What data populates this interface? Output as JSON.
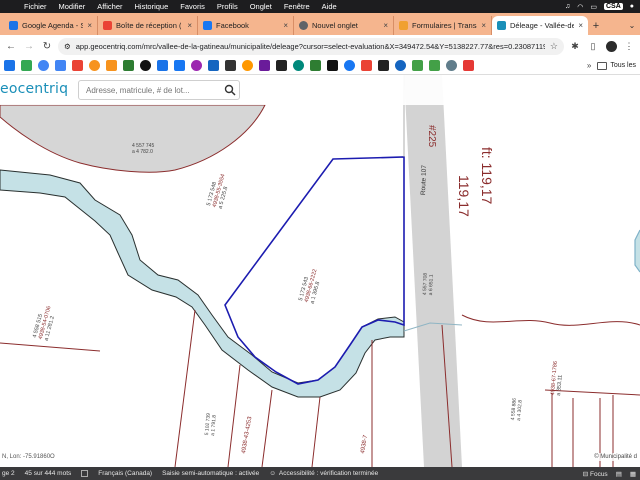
{
  "menubar": {
    "items": [
      "Fichier",
      "Modifier",
      "Afficher",
      "Historique",
      "Favoris",
      "Profils",
      "Onglet",
      "Fenêtre",
      "Aide"
    ],
    "input_lang": "CSA"
  },
  "tabs": [
    {
      "title": "Google Agenda - Se",
      "color": "#1a73e8"
    },
    {
      "title": "Boîte de réception (",
      "color": "#ea4335"
    },
    {
      "title": "Facebook",
      "color": "#1877f2"
    },
    {
      "title": "Nouvel onglet",
      "color": "#5f6368"
    },
    {
      "title": "Formulaires | Transa",
      "color": "#f0a030"
    },
    {
      "title": "Déleage - Vallée-de",
      "color": "#1a8fb8",
      "active": true
    }
  ],
  "omnibox": {
    "url": "app.geocentriq.com/mrc/vallee-de-la-gatineau/municipalite/deleage?cursor=select-evaluation&X=349472.54&Y=5138227.77&res=0.23087119..."
  },
  "bookmarks": {
    "colors": [
      "#1a73e8",
      "#34a853",
      "#4285f4",
      "#4285f4",
      "#ea4335",
      "#f7931e",
      "#f7931e",
      "#2e7d32",
      "#111111",
      "#1a73e8",
      "#1877f2",
      "#9c27b0",
      "#1565c0",
      "#333333",
      "#ff9800",
      "#6a1b9a",
      "#222222",
      "#00897b",
      "#2e7d32",
      "#111111",
      "#1877f2",
      "#ea4335",
      "#222222",
      "#1565c0",
      "#43a047",
      "#43a047",
      "#607d8b",
      "#e53935"
    ],
    "folder_label": "Tous les"
  },
  "app": {
    "logo": "eocentriq",
    "search_placeholder": "Adresse, matricule, # de lot..."
  },
  "map_labels": {
    "lot_top": "4 557 745",
    "lot_top_area": "a 4 782.0",
    "lot_left_num": "5 173 548",
    "lot_left_mat": "4938-55-3554",
    "lot_left_sup": "a 5 225.8",
    "lot_center_num": "5 173 543",
    "lot_center_mat": "4938-66-2222",
    "lot_center_sup": "a 1 395.8",
    "lot_far_left_mat": "4938-54-0706",
    "lot_far_left_num": "4 558 515",
    "lot_far_left_sup": "a 11 281.2",
    "road_number": "#225",
    "road_name": "Route 107",
    "road_lot": "4 557 708",
    "road_lot_sup": "a 6 651.1",
    "dim_large": "119,17",
    "dim_prefix": "ft: 119,17",
    "lot_br_num": "4 558 886",
    "lot_br_sup": "a 4 302.8",
    "lot_br_mat": "4938-67-1786",
    "lot_br_mat2": "a 353.11",
    "lot_bl_num": "5 102 739",
    "lot_bl_sup": "a 1 791.8",
    "lot_bl_mat": "4938-43-4253",
    "lot_bc_mat": "4938-7",
    "coords": "N, Lon: -75.91860O",
    "copyright": "© Municipalité d"
  },
  "wordbar": {
    "page": "ge 2",
    "words": "45 sur 444 mots",
    "language": "Français (Canada)",
    "autocomplete": "Saisie semi-automatique : activée",
    "accessibility": "Accessibilité : vérification terminée",
    "focus": "Focus"
  }
}
